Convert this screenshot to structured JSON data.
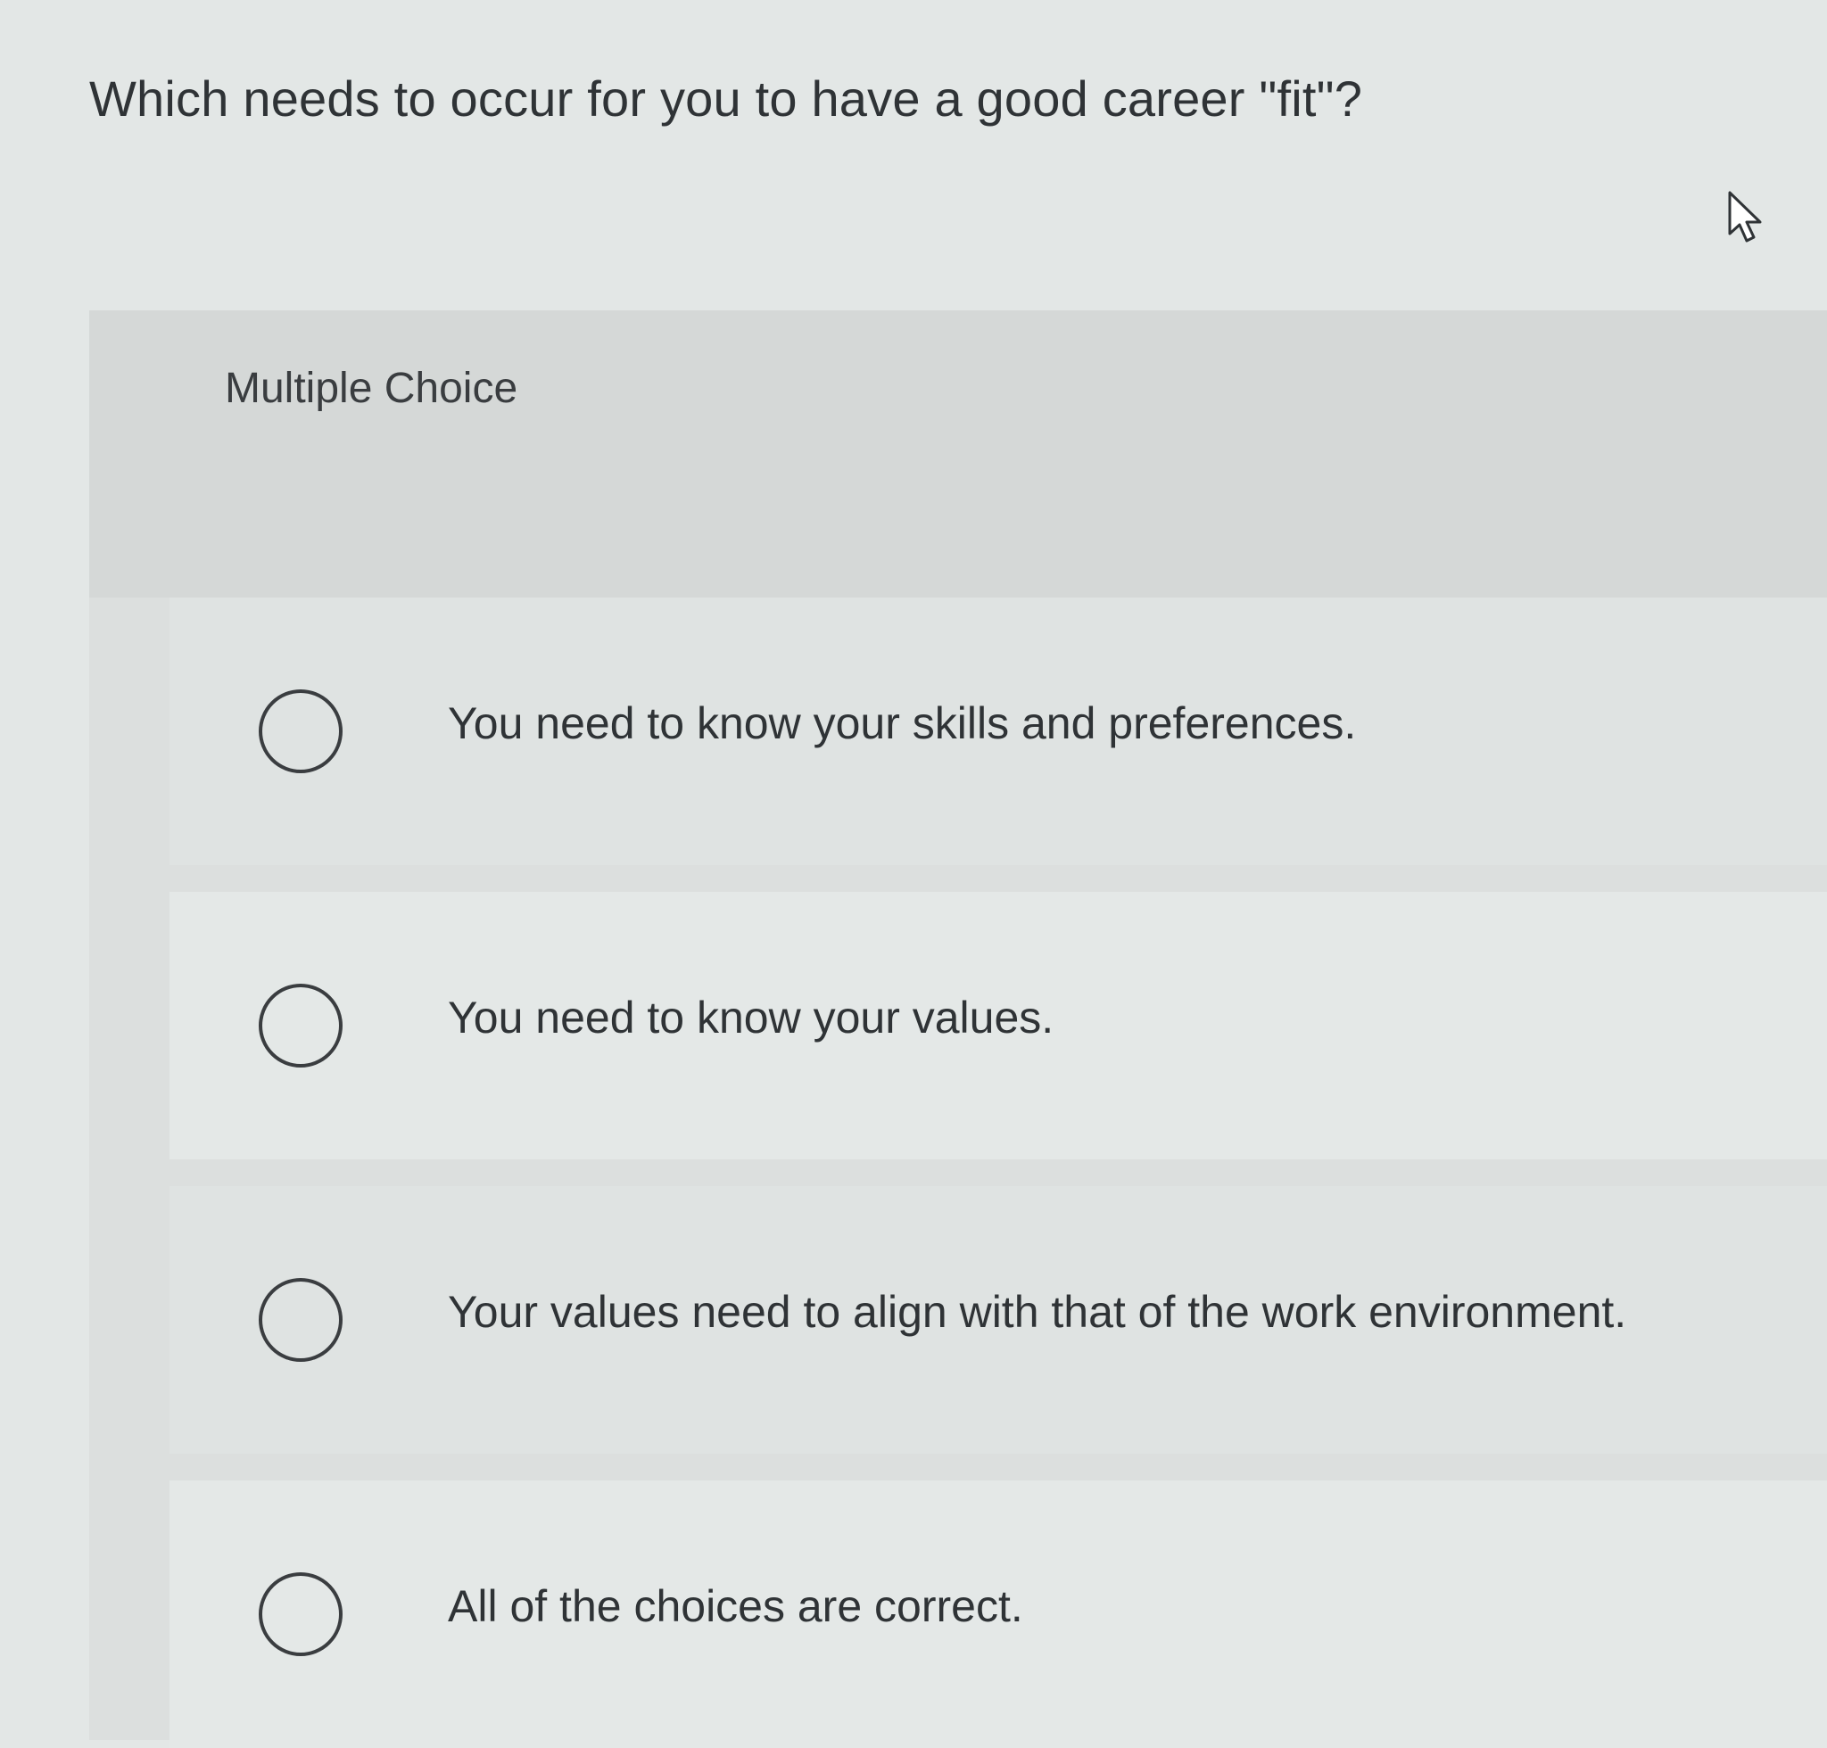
{
  "question": {
    "text": "Which needs to occur for you to have a good career \"fit\"?"
  },
  "quiz": {
    "type_label": "Multiple Choice",
    "options": [
      {
        "label": "You need to know your skills and preferences."
      },
      {
        "label": "You need to know your values."
      },
      {
        "label": "Your values need to align with that of the work environment."
      },
      {
        "label": "All of the choices are correct."
      }
    ]
  },
  "icons": {
    "cursor": "mouse-pointer-icon",
    "radio": "radio-unselected-icon"
  },
  "colors": {
    "text": "#2f3336",
    "background": "#e3e7e6",
    "panel": "#dcdfde",
    "radio_border": "#3a3d40"
  }
}
